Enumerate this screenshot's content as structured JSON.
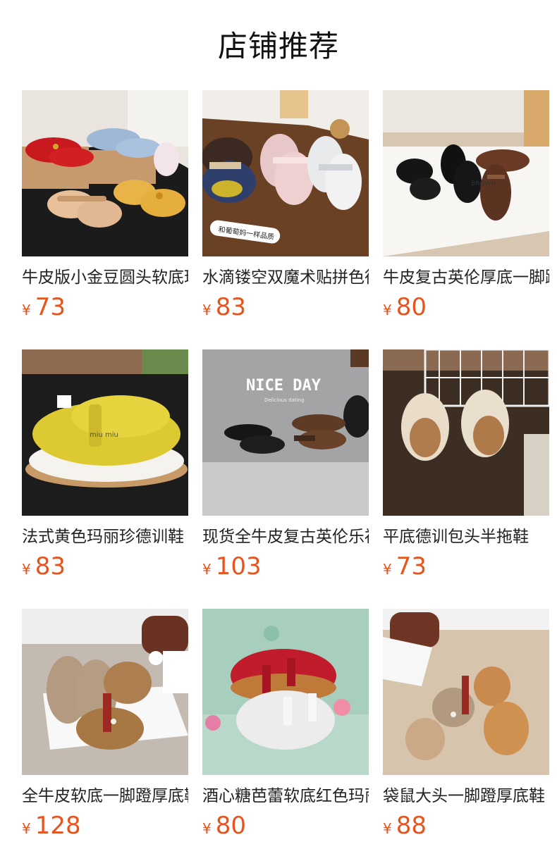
{
  "page": {
    "title": "店铺推荐",
    "accent_color": "#e8541e"
  },
  "products": [
    {
      "name": "牛皮版小金豆圆头软底玛丽珍鞋",
      "currency": "¥",
      "price": "73",
      "image": "mary-jane-shoes-photo"
    },
    {
      "name": "水滴镂空双魔术贴拼色德训鞋",
      "currency": "¥",
      "price": "83",
      "image": "velcro-sneakers-photo"
    },
    {
      "name": "牛皮复古英伦厚底一脚蹬乐福鞋",
      "currency": "¥",
      "price": "80",
      "image": "loafers-photo"
    },
    {
      "name": "法式黄色玛丽珍德训鞋",
      "currency": "¥",
      "price": "83",
      "image": "yellow-sneakers-photo"
    },
    {
      "name": "现货全牛皮复古英伦乐福鞋",
      "currency": "¥",
      "price": "103",
      "image": "nice-day-loafers-photo"
    },
    {
      "name": "平底德训包头半拖鞋",
      "currency": "¥",
      "price": "73",
      "image": "mule-slippers-photo"
    },
    {
      "name": "全牛皮软底一脚蹬厚底鞋",
      "currency": "¥",
      "price": "128",
      "image": "suede-moccasins-photo"
    },
    {
      "name": "酒心糖芭蕾软底红色玛丽珍",
      "currency": "¥",
      "price": "80",
      "image": "red-ballet-flats-photo"
    },
    {
      "name": "袋鼠大头一脚蹬厚底鞋",
      "currency": "¥",
      "price": "88",
      "image": "kangaroo-shoes-photo"
    }
  ],
  "image_overlays": {
    "nice_day": "NICE DAY",
    "nice_day_sub": "Delicious dating",
    "sticker": "和葡萄妈一样品质",
    "brand": "BROWN",
    "miu": "miu miu"
  }
}
